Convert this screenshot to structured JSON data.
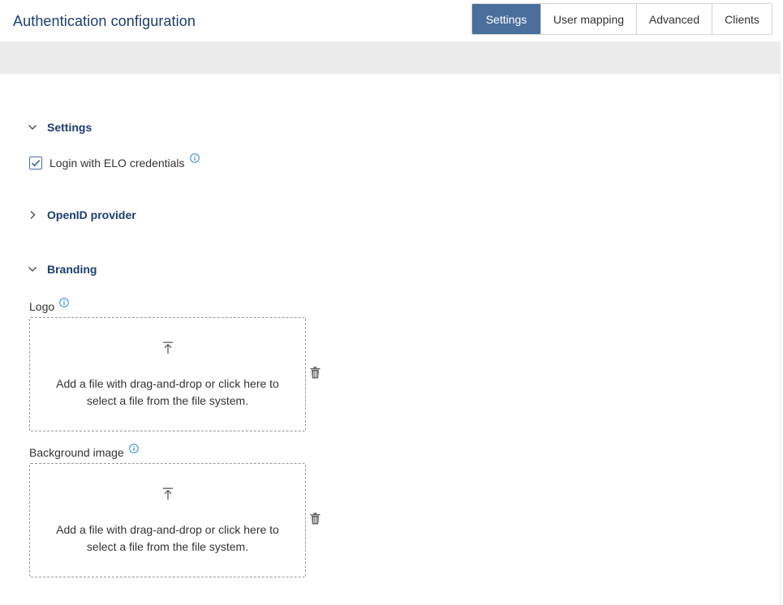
{
  "header": {
    "title": "Authentication configuration",
    "tabs": [
      {
        "label": "Settings",
        "active": true
      },
      {
        "label": "User mapping",
        "active": false
      },
      {
        "label": "Advanced",
        "active": false
      },
      {
        "label": "Clients",
        "active": false
      }
    ]
  },
  "sections": {
    "settings": {
      "label": "Settings",
      "expanded": true
    },
    "openid": {
      "label": "OpenID provider",
      "expanded": false
    },
    "branding": {
      "label": "Branding",
      "expanded": true
    }
  },
  "login_checkbox": {
    "label": "Login with ELO credentials",
    "checked": true
  },
  "branding": {
    "logo": {
      "label": "Logo",
      "dropzone_line1": "Add a file with drag-and-drop or click here to",
      "dropzone_line2": "select a file from the file system."
    },
    "background": {
      "label": "Background image",
      "dropzone_line1": "Add a file with drag-and-drop or click here to",
      "dropzone_line2": "select a file from the file system."
    }
  },
  "icons": {
    "info": "info-icon",
    "upload": "upload-icon",
    "delete": "trash-icon",
    "chevron_down": "chevron-down-icon",
    "chevron_right": "chevron-right-icon",
    "check": "check-icon"
  },
  "colors": {
    "title": "#1a3d6d",
    "tab_active_bg": "#4a6f9c",
    "info": "#2e8bd0",
    "band": "#ececed"
  }
}
